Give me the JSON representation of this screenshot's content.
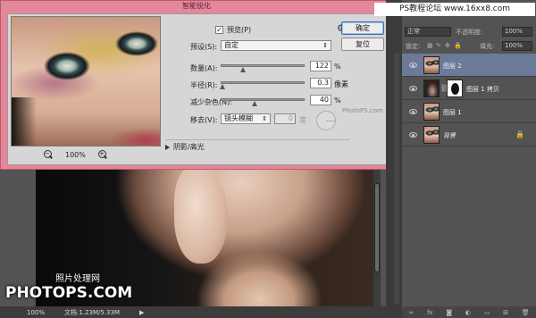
{
  "dialog": {
    "title": "智能锐化",
    "preview_label": "预览(P)",
    "preview_checked": "✓",
    "preset_label": "预设(S):",
    "preset_value": "自定",
    "ok_label": "确定",
    "reset_label": "复位",
    "amount": {
      "label": "数量(A):",
      "value": "122",
      "unit": "%",
      "level_fraction": 0.26
    },
    "radius": {
      "label": "半径(R):",
      "value": "0.3",
      "unit": "像素",
      "level_fraction": 0.02
    },
    "noise": {
      "label": "减少杂色(N):",
      "value": "40",
      "unit": "%",
      "level_fraction": 0.4
    },
    "remove": {
      "label": "移去(V):",
      "value": "镜头模糊",
      "angle_value": "0",
      "angle_unit": "度"
    },
    "shadows_highlights_label": "阴影/高光",
    "zoom": {
      "level": "100%",
      "zoom_out": "−",
      "zoom_in": "+"
    }
  },
  "canvas": {
    "watermark_cn": "照片处理网",
    "watermark_en": "PHOTOPS.COM",
    "overlay_watermark": "PhotoPS.com"
  },
  "status_bar": {
    "zoom": "100%",
    "doc_info": "文档:1.23M/5.33M"
  },
  "layers_panel": {
    "blend_mode": "正常",
    "opacity_label": "不透明度:",
    "opacity_value": "100%",
    "lock_label": "锁定:",
    "fill_label": "填充:",
    "fill_value": "100%",
    "layers": [
      {
        "name": "图层 2",
        "active": true
      },
      {
        "name": "图层 1 拷贝",
        "active": false
      },
      {
        "name": "图层 1",
        "active": false
      },
      {
        "name": "背景",
        "active": false,
        "locked": true
      }
    ],
    "bottom_icons": [
      "link-icon",
      "fx-icon",
      "mask-icon",
      "adjustment-icon",
      "folder-icon",
      "new-layer-icon",
      "trash-icon"
    ]
  },
  "site_watermark": "PS教程论坛 www.16xx8.com",
  "colors": {
    "dialog_frame": "#e5879a",
    "active_layer": "#6b7a99",
    "workspace_bg": "#535353"
  }
}
